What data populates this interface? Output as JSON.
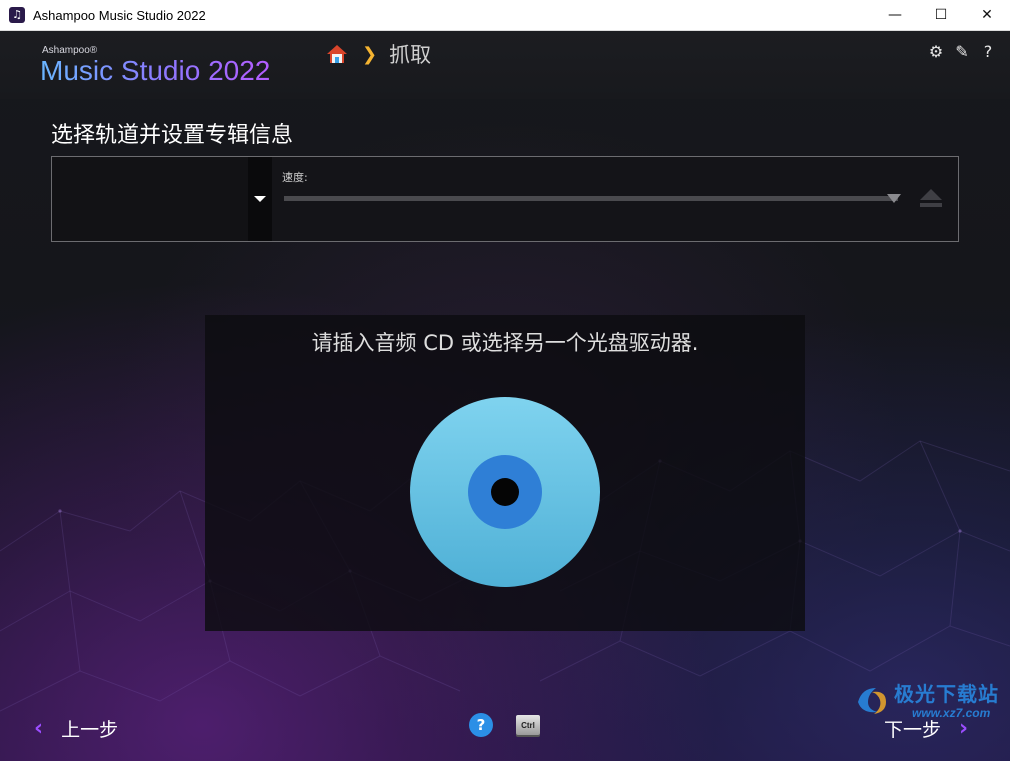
{
  "window": {
    "title": "Ashampoo Music Studio 2022",
    "controls": {
      "minimize": "—",
      "maximize": "☐",
      "close": "✕"
    }
  },
  "brand": {
    "small": "Ashampoo®",
    "main": "Music Studio 2022"
  },
  "breadcrumb": {
    "home_icon": "home-icon",
    "separator": "❯",
    "current": "抓取"
  },
  "header_tools": {
    "settings": "⚙",
    "edit": "✎",
    "help": "?"
  },
  "section": {
    "title": "选择轨道并设置专辑信息"
  },
  "drive": {
    "selected": "",
    "speed_label": "速度:"
  },
  "disc": {
    "message": "请插入音频 CD 或选择另一个光盘驱动器."
  },
  "footer": {
    "back_arrow": "‹",
    "back_label": "上一步",
    "help": "?",
    "ctrl_key": "Ctrl",
    "next_label": "下一步",
    "next_arrow": "›"
  },
  "watermark": {
    "text": "极光下载站",
    "url": "www.xz7.com"
  },
  "colors": {
    "accent": "#9b4dff",
    "help_blue": "#2b8fe6",
    "cd_light": "#74c8e6",
    "cd_dark": "#2f7fd6",
    "home_red": "#d9452b",
    "chevron_gold": "#f5b431"
  }
}
